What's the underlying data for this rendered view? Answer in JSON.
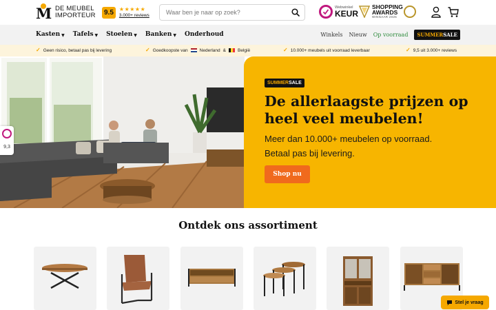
{
  "header": {
    "logo_line1": "DE MEUBEL",
    "logo_line2": "IMPORTEUR",
    "rating_score": "9.5",
    "rating_stars": "★★★★★",
    "rating_reviews": "3.000+ reviews",
    "search_placeholder": "Waar ben je naar op zoek?",
    "keur_small": "Webwinkel",
    "keur_big": "KEUR",
    "awards_title_1": "SHOPPING",
    "awards_title_2": "AWARDS",
    "awards_sub": "WINNAAR 2025",
    "icons": [
      "search-icon",
      "user-icon",
      "cart-icon"
    ]
  },
  "nav": {
    "items": [
      {
        "label": "Kasten",
        "dropdown": true
      },
      {
        "label": "Tafels",
        "dropdown": true
      },
      {
        "label": "Stoelen",
        "dropdown": true
      },
      {
        "label": "Banken",
        "dropdown": true
      },
      {
        "label": "Onderhoud",
        "dropdown": false
      }
    ],
    "right": {
      "winkels": "Winkels",
      "nieuw": "Nieuw",
      "op_voorraad": "Op voorraad",
      "sale_part1": "SUMMER",
      "sale_part2": "SALE"
    }
  },
  "usps": {
    "item1": "Geen risico, betaal pas bij levering",
    "item2_prefix": "Goedkoopste van",
    "item2_nl": "Nederland",
    "item2_amp": "&",
    "item2_be": "België",
    "item3": "10.000+ meubels uit voorraad leverbaar",
    "item4": "9,5 uit 3.000+ reviews"
  },
  "hero": {
    "badge_part1": "SUMMER",
    "badge_part2": "SALE",
    "title": "De allerlaagste prijzen op heel veel meubelen!",
    "subtitle_line1": "Meer dan 10.000+ meubelen op voorraad.",
    "subtitle_line2": "Betaal pas bij levering.",
    "button": "Shop nu"
  },
  "side_badge": {
    "score": "9,3"
  },
  "assortment": {
    "title": "Ontdek ons assortiment",
    "tiles": [
      "round-table",
      "leather-chair",
      "tv-cabinet",
      "nesting-tables",
      "display-cabinet",
      "sideboard"
    ]
  },
  "chat": {
    "label": "Stel je vraag"
  },
  "colors": {
    "accent_yellow": "#f7b500",
    "button_orange": "#f06a1d",
    "keur_magenta": "#c0187e",
    "usp_bg": "#fdf4dc",
    "nav_bg": "#f2f2f2",
    "green_link": "#2e8b3d"
  }
}
